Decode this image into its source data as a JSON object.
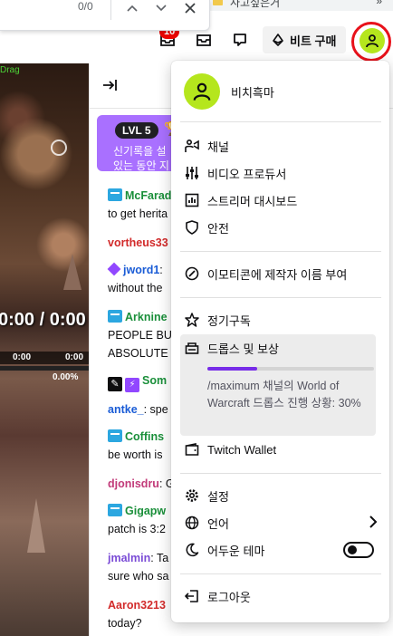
{
  "find_bar": {
    "count": "0/0",
    "bookmark_text": "사고싶은거",
    "bookmarks_more": "»"
  },
  "nav": {
    "notification_count": "10",
    "bits_label": "비트 구매"
  },
  "video": {
    "overlay_label": "Drag",
    "timer": "0:00 / 0:00",
    "stat1": "0:00",
    "stat2": "0:00",
    "percent": "0.00%"
  },
  "chat": {
    "level_badge": "LVL 5",
    "level_text_1": "신기록을 설",
    "level_text_2": "있는 동안 지",
    "messages": [
      {
        "user": "McFarad",
        "text": "",
        "cont": "to get herita",
        "color": "#1a8f3a",
        "badge": "sub"
      },
      {
        "user": "vortheus33",
        "text": "",
        "cont": "",
        "color": "#d22b2b",
        "badge": ""
      },
      {
        "user": "jword1",
        "text": ":",
        "cont": "without the",
        "color": "#1a5cd6",
        "badge": "purple"
      },
      {
        "user": "Arknine",
        "text": "",
        "cont": "PEOPLE BU",
        "cont2": "ABSOLUTE",
        "color": "#1a8f3a",
        "badge": "sub"
      },
      {
        "user": "Som",
        "text": "",
        "cont": "",
        "color": "#1a8f3a",
        "badge": "mod"
      },
      {
        "user": "antke_",
        "text": ": spe",
        "cont": "",
        "color": "#1a5cd6",
        "badge": ""
      },
      {
        "user": "Coffins",
        "text": "",
        "cont": "be worth is",
        "color": "#1a8f3a",
        "badge": "sub"
      },
      {
        "user": "djonisdru",
        "text": ": Go",
        "cont": "",
        "color": "#c23b7a",
        "badge": ""
      },
      {
        "user": "Gigapw",
        "text": "",
        "cont": "patch is 3:2",
        "color": "#1a8f3a",
        "badge": "sub"
      },
      {
        "user": "jmalmin",
        "text": ": Ta",
        "cont": "sure who sa",
        "color": "#7a4bd6",
        "badge": ""
      },
      {
        "user": "Aaron3213",
        "text": "",
        "cont": "today?",
        "color": "#d22b2b",
        "badge": ""
      }
    ]
  },
  "menu": {
    "username": "비치흑마",
    "items": {
      "channel": "채널",
      "video_producer": "비디오 프로듀서",
      "creator_dashboard": "스트리머 대시보드",
      "security": "안전",
      "emote_credit": "이모티콘에 제작자 이름 부여",
      "subscriptions": "정기구독",
      "drops": "드롭스 및 보상",
      "drops_progress_percent": 30,
      "drops_desc": "/maximum 채널의 World of Warcraft 드롭스 진행 상황: 30%",
      "wallet": "Twitch Wallet",
      "settings": "설정",
      "language": "언어",
      "dark_theme": "어두운 테마",
      "logout": "로그아웃"
    }
  }
}
